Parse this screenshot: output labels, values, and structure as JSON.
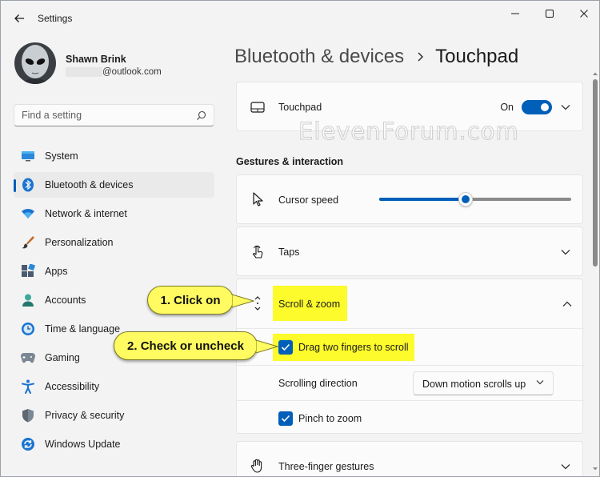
{
  "app": {
    "title": "Settings"
  },
  "user": {
    "name": "Shawn Brink",
    "email": "@outlook.com"
  },
  "search": {
    "placeholder": "Find a setting"
  },
  "nav": {
    "items": [
      {
        "label": "System",
        "icon": "monitor-icon"
      },
      {
        "label": "Bluetooth & devices",
        "icon": "bluetooth-icon",
        "selected": true
      },
      {
        "label": "Network & internet",
        "icon": "wifi-icon"
      },
      {
        "label": "Personalization",
        "icon": "paintbrush-icon"
      },
      {
        "label": "Apps",
        "icon": "apps-icon"
      },
      {
        "label": "Accounts",
        "icon": "person-icon"
      },
      {
        "label": "Time & language",
        "icon": "clock-globe-icon"
      },
      {
        "label": "Gaming",
        "icon": "gamepad-icon"
      },
      {
        "label": "Accessibility",
        "icon": "accessibility-icon"
      },
      {
        "label": "Privacy & security",
        "icon": "shield-icon"
      },
      {
        "label": "Windows Update",
        "icon": "update-icon"
      }
    ]
  },
  "breadcrumb": {
    "parent": "Bluetooth & devices",
    "current": "Touchpad"
  },
  "touchpad": {
    "label": "Touchpad",
    "toggle_state": "On",
    "toggle_on": true
  },
  "gestures": {
    "section_title": "Gestures & interaction",
    "cursor_speed": {
      "label": "Cursor speed",
      "value_fraction": 0.45
    },
    "taps": {
      "label": "Taps"
    },
    "scroll_zoom": {
      "label": "Scroll & zoom",
      "drag_two_fingers": {
        "label": "Drag two fingers to scroll",
        "checked": true
      },
      "scrolling_direction": {
        "label": "Scrolling direction",
        "value": "Down motion scrolls up"
      },
      "pinch_to_zoom": {
        "label": "Pinch to zoom",
        "checked": true
      }
    },
    "three_finger": {
      "label": "Three-finger gestures"
    }
  },
  "watermark": "ElevenForum.com",
  "callouts": {
    "step1": "1. Click on",
    "step2": "2. Check or uncheck"
  },
  "colors": {
    "accent": "#005fb8",
    "highlight": "#fdfb2c",
    "callout": "#fffb60"
  }
}
